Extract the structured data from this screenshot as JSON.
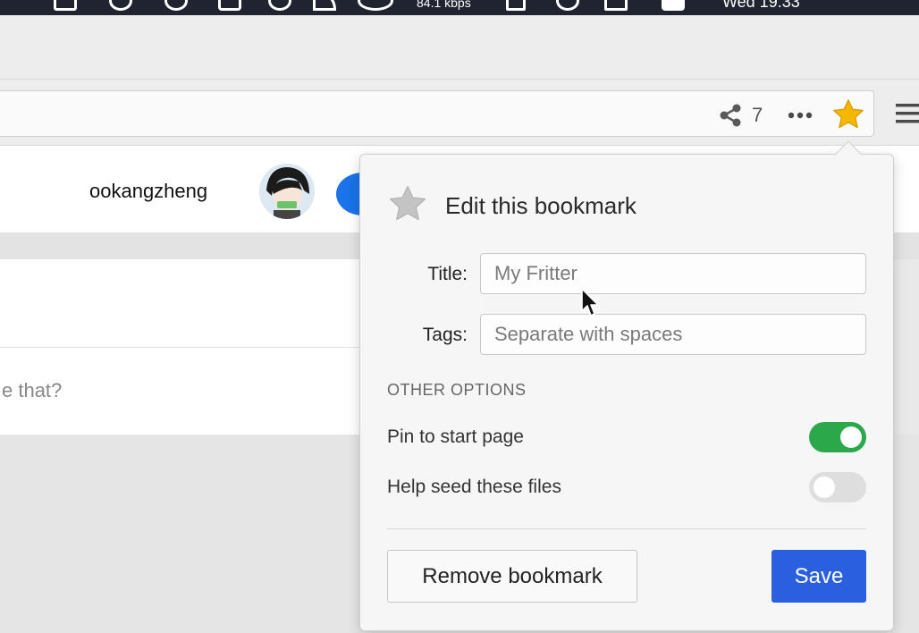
{
  "menubar": {
    "net_speed": "84.1 kbps",
    "clock": "Wed 19:33"
  },
  "toolbar": {
    "share_icon": "share-icon",
    "share_count": "7",
    "more_icon": "more-dots-icon",
    "bookmark_star_icon": "star-icon",
    "bookmark_star_color": "#f5b800",
    "menu_icon": "hamburger-menu-icon"
  },
  "page": {
    "username": "ookangzheng",
    "post_prompt": "e that?"
  },
  "bookmark_popup": {
    "title": "Edit this bookmark",
    "title_label": "Title:",
    "title_value": "",
    "title_placeholder": "My Fritter",
    "tags_label": "Tags:",
    "tags_value": "",
    "tags_placeholder": "Separate with spaces",
    "section_heading": "OTHER OPTIONS",
    "options": [
      {
        "label": "Pin to start page",
        "enabled": true
      },
      {
        "label": "Help seed these files",
        "enabled": false
      }
    ],
    "remove_label": "Remove bookmark",
    "save_label": "Save",
    "accent_color": "#2a60e0",
    "toggle_on_color": "#2aa84a"
  }
}
